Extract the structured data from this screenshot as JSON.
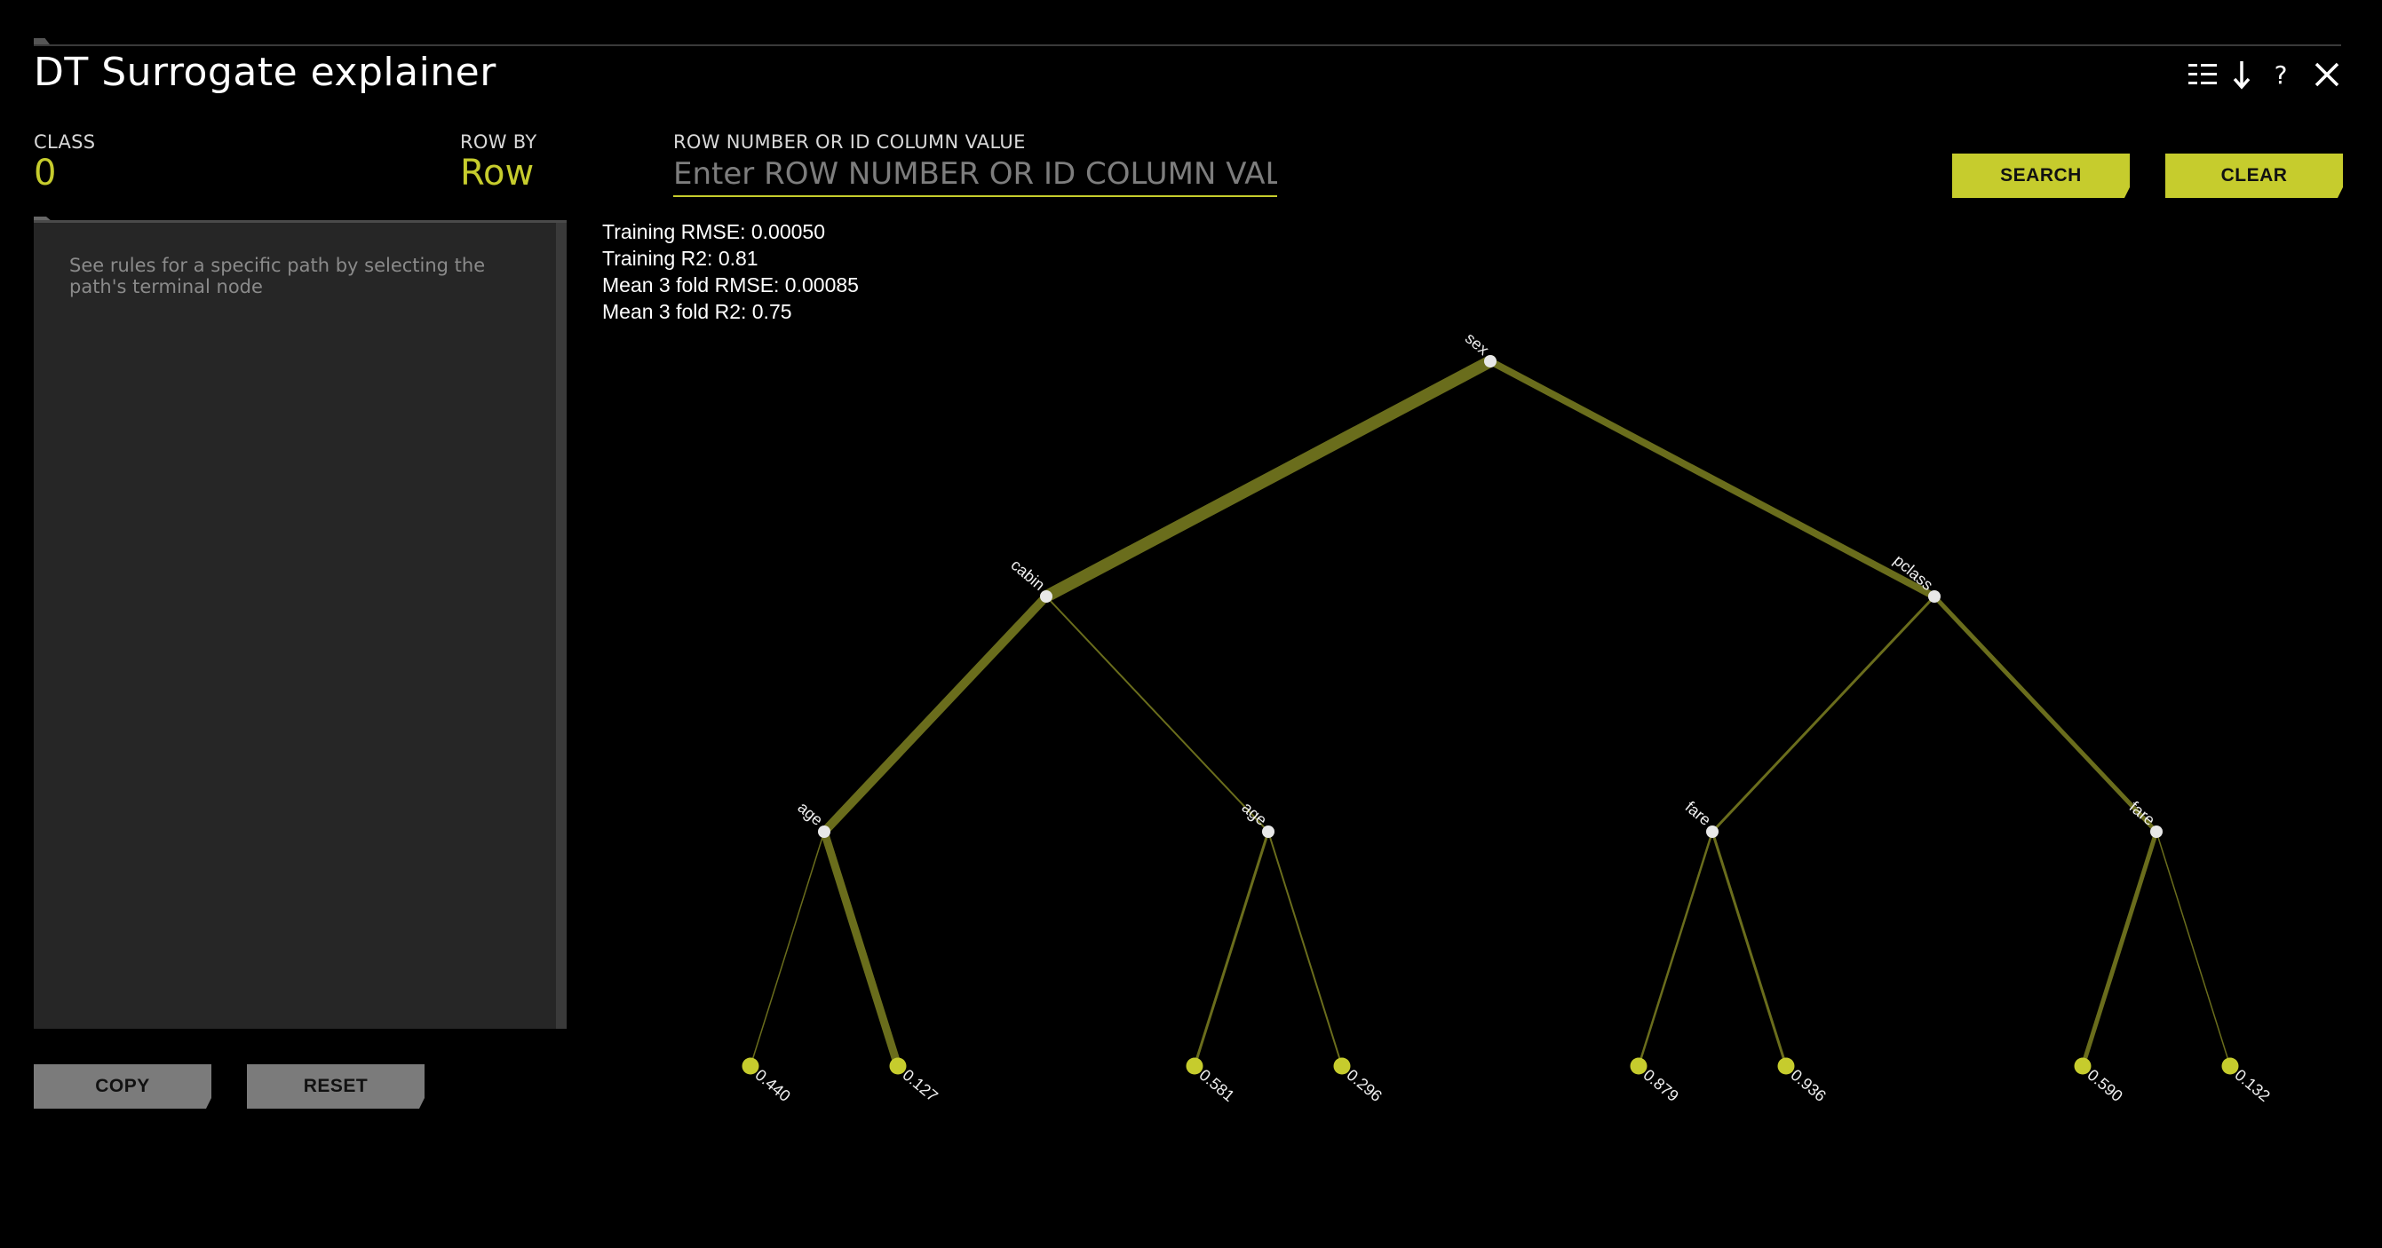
{
  "app": {
    "title": "DT Surrogate explainer"
  },
  "header_icons": [
    "list-icon",
    "download-icon",
    "help-icon",
    "close-icon"
  ],
  "icons": {
    "help": "?"
  },
  "controls": {
    "class_label": "CLASS",
    "class_value": "0",
    "row_by_label": "ROW BY",
    "row_by_value": "Row",
    "search_label": "ROW NUMBER OR ID COLUMN VALUE",
    "search_placeholder": "Enter ROW NUMBER OR ID COLUMN VALUE",
    "search_value": "",
    "search_button": "SEARCH",
    "clear_button": "CLEAR"
  },
  "rules_panel": {
    "hint": "See rules for a specific path by selecting the path's terminal node",
    "copy_button": "COPY",
    "reset_button": "RESET"
  },
  "metrics": [
    "Training RMSE: 0.00050",
    "Training R2: 0.81",
    "Mean 3 fold RMSE: 0.00085",
    "Mean 3 fold R2: 0.75"
  ],
  "colors": {
    "accent": "#c6cc2d",
    "edge": "#6a6d1c",
    "node": "#e8e8e8",
    "background": "#000000"
  },
  "tree": {
    "root": {
      "label": "sex"
    },
    "level1": [
      {
        "label": "cabin"
      },
      {
        "label": "pclass"
      }
    ],
    "level2": [
      {
        "label": "age"
      },
      {
        "label": "age"
      },
      {
        "label": "fare"
      },
      {
        "label": "fare"
      }
    ],
    "leaves": [
      {
        "value": "0.440"
      },
      {
        "value": "0.127"
      },
      {
        "value": "0.581"
      },
      {
        "value": "0.296"
      },
      {
        "value": "0.879"
      },
      {
        "value": "0.936"
      },
      {
        "value": "0.590"
      },
      {
        "value": "0.132"
      }
    ]
  }
}
